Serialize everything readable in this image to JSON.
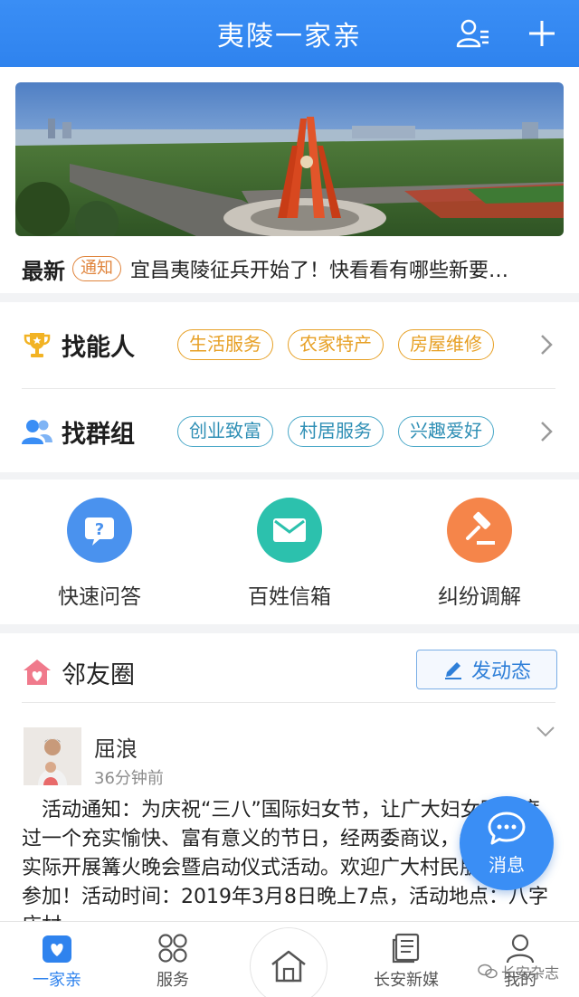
{
  "header": {
    "title": "夷陵一家亲"
  },
  "news": {
    "tag": "最新",
    "badge": "通知",
    "text": "宜昌夷陵征兵开始了！快看看有哪些新要…"
  },
  "find_people": {
    "label": "找能人",
    "chips": [
      "生活服务",
      "农家特产",
      "房屋维修"
    ]
  },
  "find_groups": {
    "label": "找群组",
    "chips": [
      "创业致富",
      "村居服务",
      "兴趣爱好"
    ]
  },
  "quick_actions": [
    {
      "label": "快速问答"
    },
    {
      "label": "百姓信箱"
    },
    {
      "label": "纠纷调解"
    }
  ],
  "feed": {
    "title": "邻友圈",
    "post_button": "发动态",
    "post": {
      "user": "屈浪",
      "time": "36分钟前",
      "body": "活动通知：为庆祝“三八”国际妇女节，让广大妇女同志度过一个充实愉快、富有意义的节日，经两委商议，结合本村实际开展篝火晚会暨启动仪式活动。欢迎广大村民朋友踊跃参加！活动时间：2019年3月8日晚上7点，活动地点：八字庄村"
    }
  },
  "fab": {
    "label": "消息"
  },
  "tabs": [
    {
      "label": "一家亲"
    },
    {
      "label": "服务"
    },
    {
      "label": "长安新媒"
    },
    {
      "label": "我的"
    }
  ],
  "watermark": "长安杂志",
  "colors": {
    "primary": "#2f83ee",
    "orange_chip": "#e7a025",
    "teal_chip": "#2f8fb5"
  }
}
